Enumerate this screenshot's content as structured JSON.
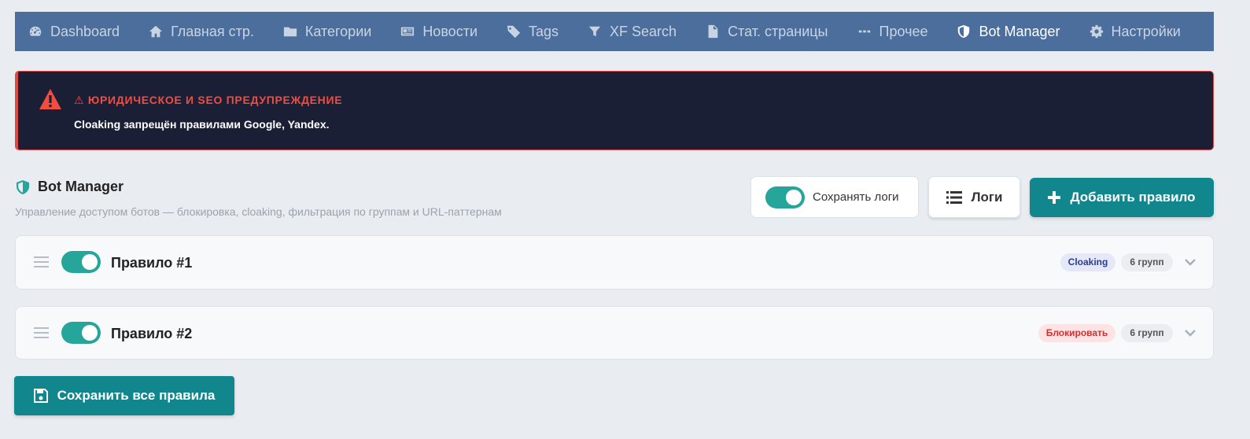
{
  "nav": {
    "items": [
      {
        "label": "Dashboard",
        "icon": "dashboard-icon"
      },
      {
        "label": "Главная стр.",
        "icon": "home-icon"
      },
      {
        "label": "Категории",
        "icon": "folder-icon"
      },
      {
        "label": "Новости",
        "icon": "newspaper-icon"
      },
      {
        "label": "Tags",
        "icon": "tags-icon"
      },
      {
        "label": "XF Search",
        "icon": "filter-icon"
      },
      {
        "label": "Стат. страницы",
        "icon": "file-icon"
      },
      {
        "label": "Прочее",
        "icon": "ellipsis-icon"
      },
      {
        "label": "Bot Manager",
        "icon": "shield-icon",
        "active": true
      },
      {
        "label": "Настройки",
        "icon": "gear-icon"
      }
    ]
  },
  "warning": {
    "title": "⚠ ЮРИДИЧЕСКОЕ И SEO ПРЕДУПРЕЖДЕНИЕ",
    "text": "Cloaking запрещён правилами Google, Yandex."
  },
  "header": {
    "title": "Bot Manager",
    "subtitle": "Управление доступом ботов — блокировка, cloaking, фильтрация по группам и URL-паттернам"
  },
  "actions": {
    "save_logs_label": "Сохранять логи",
    "save_logs_on": true,
    "logs_label": "Логи",
    "add_rule_label": "Добавить правило"
  },
  "rules": [
    {
      "name": "Правило #1",
      "enabled": true,
      "action": "Cloaking",
      "groups": "6 групп"
    },
    {
      "name": "Правило #2",
      "enabled": true,
      "action": "Блокировать",
      "groups": "6 групп"
    }
  ],
  "footer": {
    "save_all_label": "Сохранить все правила"
  },
  "colors": {
    "nav_bg": "#4c6e9c",
    "accent": "#12868d",
    "toggle_on": "#26a69a",
    "danger": "#e04848",
    "warning_bg": "#1b1f36"
  }
}
